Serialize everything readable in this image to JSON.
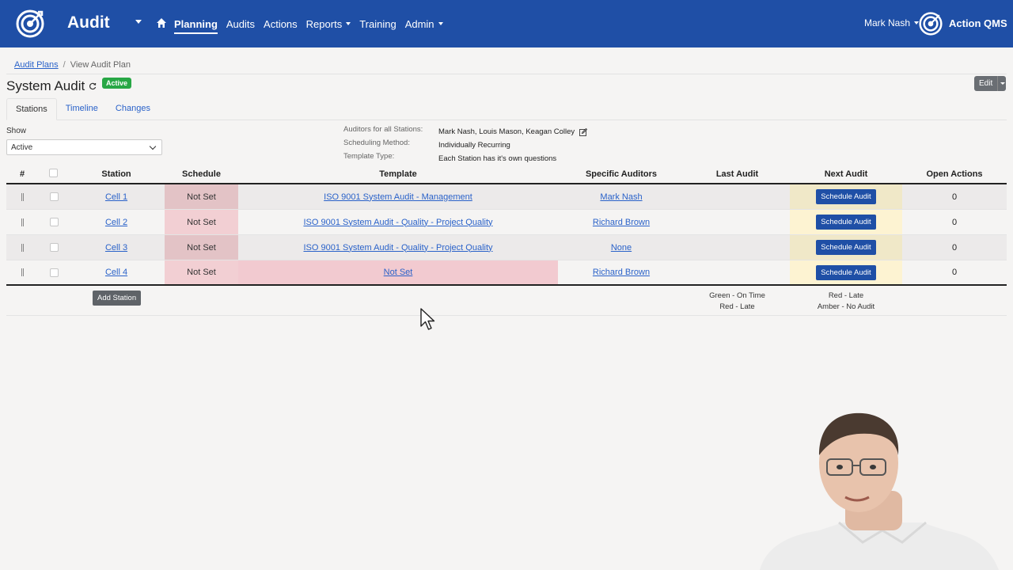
{
  "navbar": {
    "app_title": "Audit",
    "menu": [
      {
        "label": "Planning",
        "active": true,
        "dropdown": false
      },
      {
        "label": "Audits",
        "active": false,
        "dropdown": false
      },
      {
        "label": "Actions",
        "active": false,
        "dropdown": false
      },
      {
        "label": "Reports",
        "active": false,
        "dropdown": true
      },
      {
        "label": "Training",
        "active": false,
        "dropdown": false
      },
      {
        "label": "Admin",
        "active": false,
        "dropdown": true
      }
    ],
    "user": "Mark Nash",
    "brand": "Action QMS",
    "color": "#1f4fa6"
  },
  "breadcrumb": {
    "parent": "Audit Plans",
    "separator": "/",
    "current": "View Audit Plan"
  },
  "page": {
    "title": "System Audit",
    "status": "Active",
    "status_color": "#28a745",
    "edit_label": "Edit"
  },
  "tabs": [
    "Stations",
    "Timeline",
    "Changes"
  ],
  "filter": {
    "label": "Show",
    "value": "Active"
  },
  "info": [
    {
      "key": "Auditors for all Stations:",
      "value": "Mark Nash, Louis Mason, Keagan Colley"
    },
    {
      "key": "Scheduling Method:",
      "value": "Individually Recurring"
    },
    {
      "key": "Template Type:",
      "value": "Each Station has it's own questions"
    }
  ],
  "table": {
    "columns": [
      "#",
      "",
      "Station",
      "Schedule",
      "Template",
      "Specific Auditors",
      "Last Audit",
      "Next Audit",
      "Open Actions"
    ],
    "rows": [
      {
        "station": "Cell 1",
        "schedule": "Not Set",
        "template": "ISO 9001 System Audit - Management",
        "template_set": true,
        "auditors": "Mark Nash",
        "last_audit": "",
        "next_audit": "Schedule Audit",
        "open_actions": "0"
      },
      {
        "station": "Cell 2",
        "schedule": "Not Set",
        "template": "ISO 9001 System Audit - Quality - Project Quality",
        "template_set": true,
        "auditors": "Richard Brown",
        "last_audit": "",
        "next_audit": "Schedule Audit",
        "open_actions": "0"
      },
      {
        "station": "Cell 3",
        "schedule": "Not Set",
        "template": "ISO 9001 System Audit - Quality - Project Quality",
        "template_set": true,
        "auditors": "None",
        "last_audit": "",
        "next_audit": "Schedule Audit",
        "open_actions": "0"
      },
      {
        "station": "Cell 4",
        "schedule": "Not Set",
        "template": "Not Set",
        "template_set": false,
        "auditors": "Richard Brown",
        "last_audit": "",
        "next_audit": "Schedule Audit",
        "open_actions": "0"
      }
    ],
    "add_station_label": "Add Station",
    "legend_last": [
      "Green - On Time",
      "Red - Late"
    ],
    "legend_next": [
      "Red - Late",
      "Amber - No Audit"
    ]
  }
}
